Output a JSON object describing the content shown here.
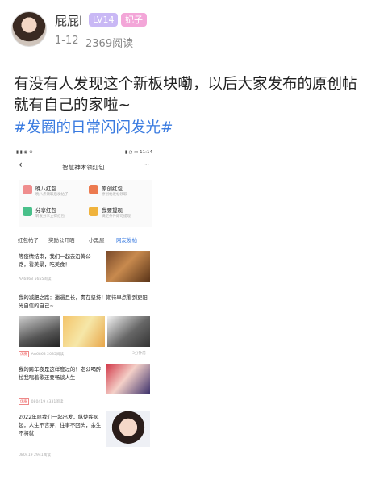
{
  "post": {
    "username": "屁屁l",
    "level_badge": "LV14",
    "title_badge": "妃子",
    "date": "1-12",
    "read_count": "2369阅读",
    "text": "有没有人发现这个新板块嘞，以后大家发布的原创帖就有自己的家啦~",
    "hashtag": "#发圈的日常闪闪发光#"
  },
  "screenshot": {
    "status_time": "11:14",
    "header_title": "智慧神木领红包",
    "grid": [
      {
        "label": "晚八红包",
        "sub": "晚八点领取后发帖子",
        "color": "#ef8d8d"
      },
      {
        "label": "原创红包",
        "sub": "原创帖发帖领取",
        "color": "#ec7a4f"
      },
      {
        "label": "分享红包",
        "sub": "转发分享立得红包",
        "color": "#49c08a"
      },
      {
        "label": "我要提现",
        "sub": "满足条件即可提现",
        "color": "#f0b33c"
      }
    ],
    "tabs": [
      "红包帖子",
      "奖励公开晒",
      "小黑屋",
      "网友发帖"
    ],
    "active_tab": 3,
    "posts": [
      {
        "text": "等疫情结束，我们一起去沿黄公路，看美景，吃美食！",
        "meta": "AA6868  5655阅读"
      },
      {
        "text": "我的减肥之路：邋遢且长，贵在坚持！期待早点看到更阳光自信的自己~",
        "meta": "AA6868  2035阅读",
        "tag": "优质",
        "time": "3分钟前"
      },
      {
        "text": "我的跨年夜是这样度过的！老公喝醉拉我唱着歌还要畅谈人生",
        "meta": "080419  4331阅读",
        "tag": "优质"
      },
      {
        "text": "2022年愿我们一起出发，纵使疾风起，人生不言弃，往事不回头，余生不将就",
        "meta": "080419  2941阅读"
      }
    ]
  }
}
